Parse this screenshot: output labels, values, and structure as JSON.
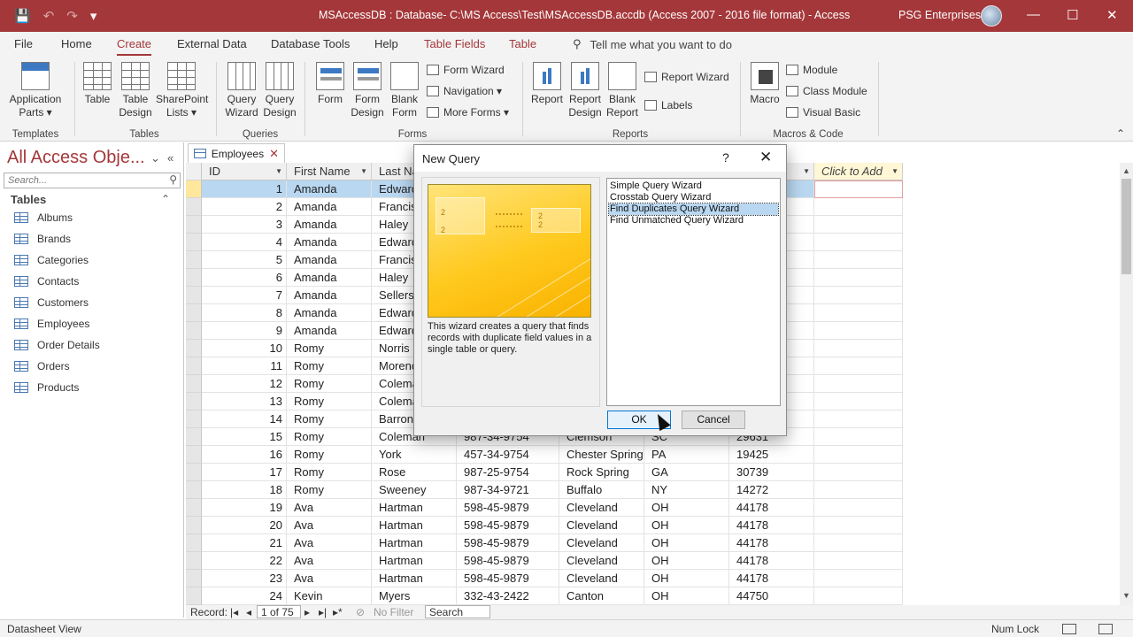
{
  "window": {
    "title": "MSAccessDB : Database- C:\\MS Access\\Test\\MSAccessDB.accdb (Access 2007 - 2016 file format)  -  Access",
    "user": "PSG Enterprises",
    "accent_color": "#a4373a",
    "qat": {
      "save": "💾",
      "undo": "↶",
      "redo": "↷",
      "customize": "▾"
    },
    "controls": {
      "minimize": "—",
      "restore": "☐",
      "close": "✕"
    }
  },
  "ribbon_tabs": [
    "File",
    "Home",
    "Create",
    "External Data",
    "Database Tools",
    "Help",
    "Table Fields",
    "Table"
  ],
  "active_tab": "Create",
  "tell_me": "Tell me what you want to do",
  "ribbon": {
    "templates": {
      "application_parts": "Application Parts ▾",
      "label": "Templates"
    },
    "tables": {
      "table": "Table",
      "table_design": "Table Design",
      "sharepoint_lists": "SharePoint Lists ▾",
      "label": "Tables"
    },
    "queries": {
      "query_wizard": "Query Wizard",
      "query_design": "Query Design",
      "label": "Queries"
    },
    "forms": {
      "form": "Form",
      "form_design": "Form Design",
      "blank_form": "Blank Form",
      "form_wizard": "Form Wizard",
      "navigation": "Navigation ▾",
      "more_forms": "More Forms ▾",
      "label": "Forms"
    },
    "reports": {
      "report": "Report",
      "report_design": "Report Design",
      "blank_report": "Blank Report",
      "report_wizard": "Report Wizard",
      "labels": "Labels",
      "label": "Reports"
    },
    "macros": {
      "macro": "Macro",
      "module": "Module",
      "class_module": "Class Module",
      "visual_basic": "Visual Basic",
      "label": "Macros & Code"
    },
    "collapse": "⌃"
  },
  "nav_pane": {
    "title": "All Access Obje...",
    "search_placeholder": "Search...",
    "section": "Tables",
    "items": [
      "Albums",
      "Brands",
      "Categories",
      "Contacts",
      "Customers",
      "Employees",
      "Order Details",
      "Orders",
      "Products"
    ]
  },
  "doc_tab": {
    "label": "Employees",
    "close": "✕"
  },
  "datasheet": {
    "headers": [
      "ID",
      "First Name",
      "Last Na",
      "",
      "",
      "",
      "",
      "Click to Add"
    ],
    "rows": [
      {
        "id": "1",
        "first": "Amanda",
        "last": "Edward",
        "phone": "",
        "city": "",
        "state": "",
        "zip": ""
      },
      {
        "id": "2",
        "first": "Amanda",
        "last": "Francis",
        "phone": "",
        "city": "",
        "state": "",
        "zip": ""
      },
      {
        "id": "3",
        "first": "Amanda",
        "last": "Haley",
        "phone": "",
        "city": "",
        "state": "",
        "zip": ""
      },
      {
        "id": "4",
        "first": "Amanda",
        "last": "Edward",
        "phone": "",
        "city": "",
        "state": "",
        "zip": ""
      },
      {
        "id": "5",
        "first": "Amanda",
        "last": "Francis",
        "phone": "",
        "city": "",
        "state": "",
        "zip": ""
      },
      {
        "id": "6",
        "first": "Amanda",
        "last": "Haley",
        "phone": "",
        "city": "",
        "state": "",
        "zip": ""
      },
      {
        "id": "7",
        "first": "Amanda",
        "last": "Sellers",
        "phone": "",
        "city": "",
        "state": "",
        "zip": ""
      },
      {
        "id": "8",
        "first": "Amanda",
        "last": "Edward",
        "phone": "",
        "city": "",
        "state": "",
        "zip": ""
      },
      {
        "id": "9",
        "first": "Amanda",
        "last": "Edward",
        "phone": "",
        "city": "",
        "state": "",
        "zip": ""
      },
      {
        "id": "10",
        "first": "Romy",
        "last": "Norris",
        "phone": "",
        "city": "",
        "state": "",
        "zip": ""
      },
      {
        "id": "11",
        "first": "Romy",
        "last": "Morenc",
        "phone": "",
        "city": "",
        "state": "",
        "zip": ""
      },
      {
        "id": "12",
        "first": "Romy",
        "last": "Colema",
        "phone": "",
        "city": "",
        "state": "",
        "zip": ""
      },
      {
        "id": "13",
        "first": "Romy",
        "last": "Colema",
        "phone": "",
        "city": "",
        "state": "",
        "zip": ""
      },
      {
        "id": "14",
        "first": "Romy",
        "last": "Barron",
        "phone": "",
        "city": "",
        "state": "",
        "zip": ""
      },
      {
        "id": "15",
        "first": "Romy",
        "last": "Coleman",
        "phone": "987-34-9754",
        "city": "Clemson",
        "state": "SC",
        "zip": "29631"
      },
      {
        "id": "16",
        "first": "Romy",
        "last": "York",
        "phone": "457-34-9754",
        "city": "Chester Spring",
        "state": "PA",
        "zip": "19425"
      },
      {
        "id": "17",
        "first": "Romy",
        "last": "Rose",
        "phone": "987-25-9754",
        "city": "Rock Spring",
        "state": "GA",
        "zip": "30739"
      },
      {
        "id": "18",
        "first": "Romy",
        "last": "Sweeney",
        "phone": "987-34-9721",
        "city": "Buffalo",
        "state": "NY",
        "zip": "14272"
      },
      {
        "id": "19",
        "first": "Ava",
        "last": "Hartman",
        "phone": "598-45-9879",
        "city": "Cleveland",
        "state": "OH",
        "zip": "44178"
      },
      {
        "id": "20",
        "first": "Ava",
        "last": "Hartman",
        "phone": "598-45-9879",
        "city": "Cleveland",
        "state": "OH",
        "zip": "44178"
      },
      {
        "id": "21",
        "first": "Ava",
        "last": "Hartman",
        "phone": "598-45-9879",
        "city": "Cleveland",
        "state": "OH",
        "zip": "44178"
      },
      {
        "id": "22",
        "first": "Ava",
        "last": "Hartman",
        "phone": "598-45-9879",
        "city": "Cleveland",
        "state": "OH",
        "zip": "44178"
      },
      {
        "id": "23",
        "first": "Ava",
        "last": "Hartman",
        "phone": "598-45-9879",
        "city": "Cleveland",
        "state": "OH",
        "zip": "44178"
      },
      {
        "id": "24",
        "first": "Kevin",
        "last": "Myers",
        "phone": "332-43-2422",
        "city": "Canton",
        "state": "OH",
        "zip": "44750"
      }
    ],
    "selected_row": 0
  },
  "record_nav": {
    "label": "Record:",
    "position": "1 of 75",
    "filter": "No Filter",
    "search": "Search"
  },
  "status": {
    "view": "Datasheet View",
    "num_lock": "Num Lock"
  },
  "dialog": {
    "title": "New Query",
    "help": "?",
    "close": "✕",
    "description": "This wizard creates a query that finds records with duplicate field values in a single table or query.",
    "options": [
      "Simple Query Wizard",
      "Crosstab Query Wizard",
      "Find Duplicates Query Wizard",
      "Find Unmatched Query Wizard"
    ],
    "selected_option": 2,
    "ok": "OK",
    "cancel": "Cancel"
  }
}
